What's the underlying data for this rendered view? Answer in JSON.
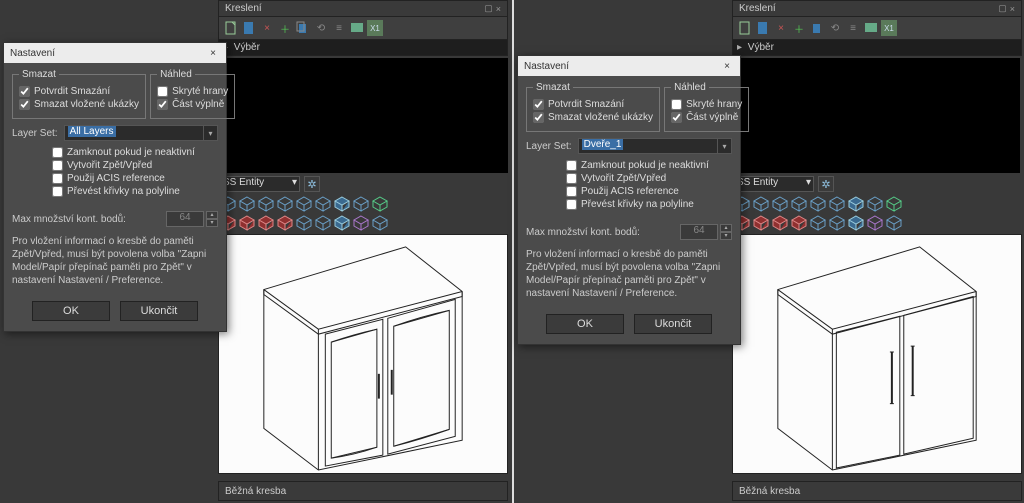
{
  "panel_title": "Kreslení",
  "tree_item": "Výběr",
  "entity_label": "SS Entity",
  "bottom_label": "Běžná kresba",
  "dialog": {
    "title": "Nastavení",
    "fs_delete": "Smazat",
    "fs_preview": "Náhled",
    "chk_confirm": "Potvrdit Smazání",
    "chk_samples": "Smazat vložené ukázky",
    "chk_hidden": "Skryté hrany",
    "chk_fill": "Část výplně",
    "layerset_label": "Layer Set:",
    "opts": {
      "lock": "Zamknout pokud je neaktivní",
      "undo": "Vytvořit Zpět/Vpřed",
      "acis": "Použij ACIS reference",
      "poly": "Převést křivky na polyline"
    },
    "max_label": "Max množství kont. bodů:",
    "max_value": "64",
    "info": "Pro vložení informací o kresbě do paměti Zpět/Vpřed, musí být povolena volba \"Zapni Model/Papír přepínač paměti pro Zpět\" v nastavení Nastavení / Preference.",
    "ok": "OK",
    "cancel": "Ukončit"
  },
  "left": {
    "layerset_value": "All Layers"
  },
  "right": {
    "layerset_value": "Dveře_1"
  }
}
